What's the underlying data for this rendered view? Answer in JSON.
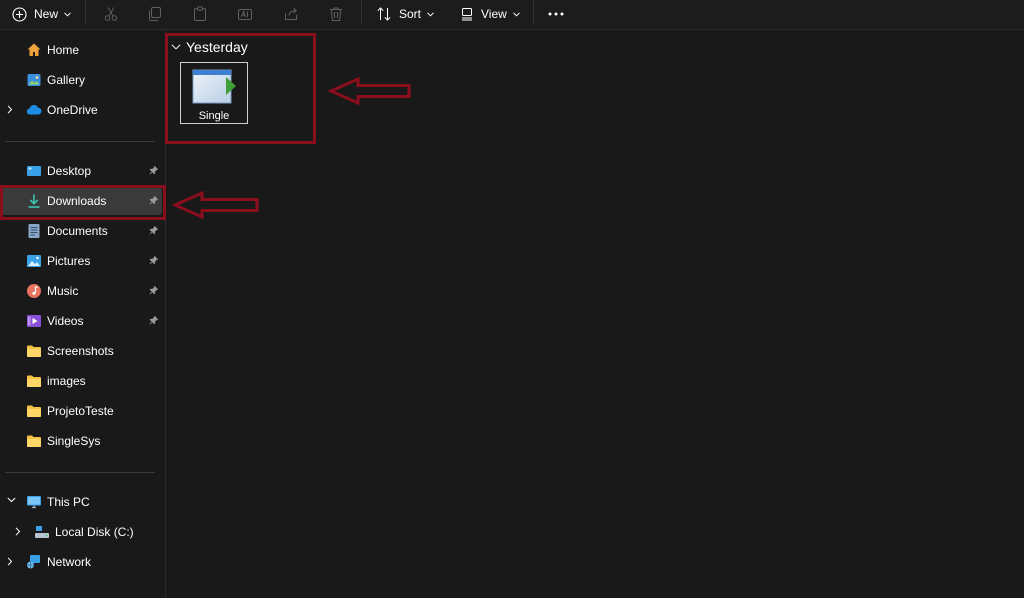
{
  "toolbar": {
    "new_label": "New",
    "sort_label": "Sort",
    "view_label": "View"
  },
  "sidebar": {
    "home": "Home",
    "gallery": "Gallery",
    "onedrive": "OneDrive",
    "desktop": "Desktop",
    "downloads": "Downloads",
    "documents": "Documents",
    "pictures": "Pictures",
    "music": "Music",
    "videos": "Videos",
    "screenshots": "Screenshots",
    "images": "images",
    "projetoteste": "ProjetoTeste",
    "singlesys": "SingleSys",
    "this_pc": "This PC",
    "local_disk": "Local Disk (C:)",
    "network": "Network"
  },
  "content": {
    "group_label": "Yesterday",
    "files": [
      {
        "name": "Single"
      }
    ]
  },
  "colors": {
    "background": "#191919",
    "selection": "#3a3a3a",
    "annotation": "#8b0e1c",
    "folder": "#f4c246",
    "accent_blue": "#4aa3f0"
  }
}
